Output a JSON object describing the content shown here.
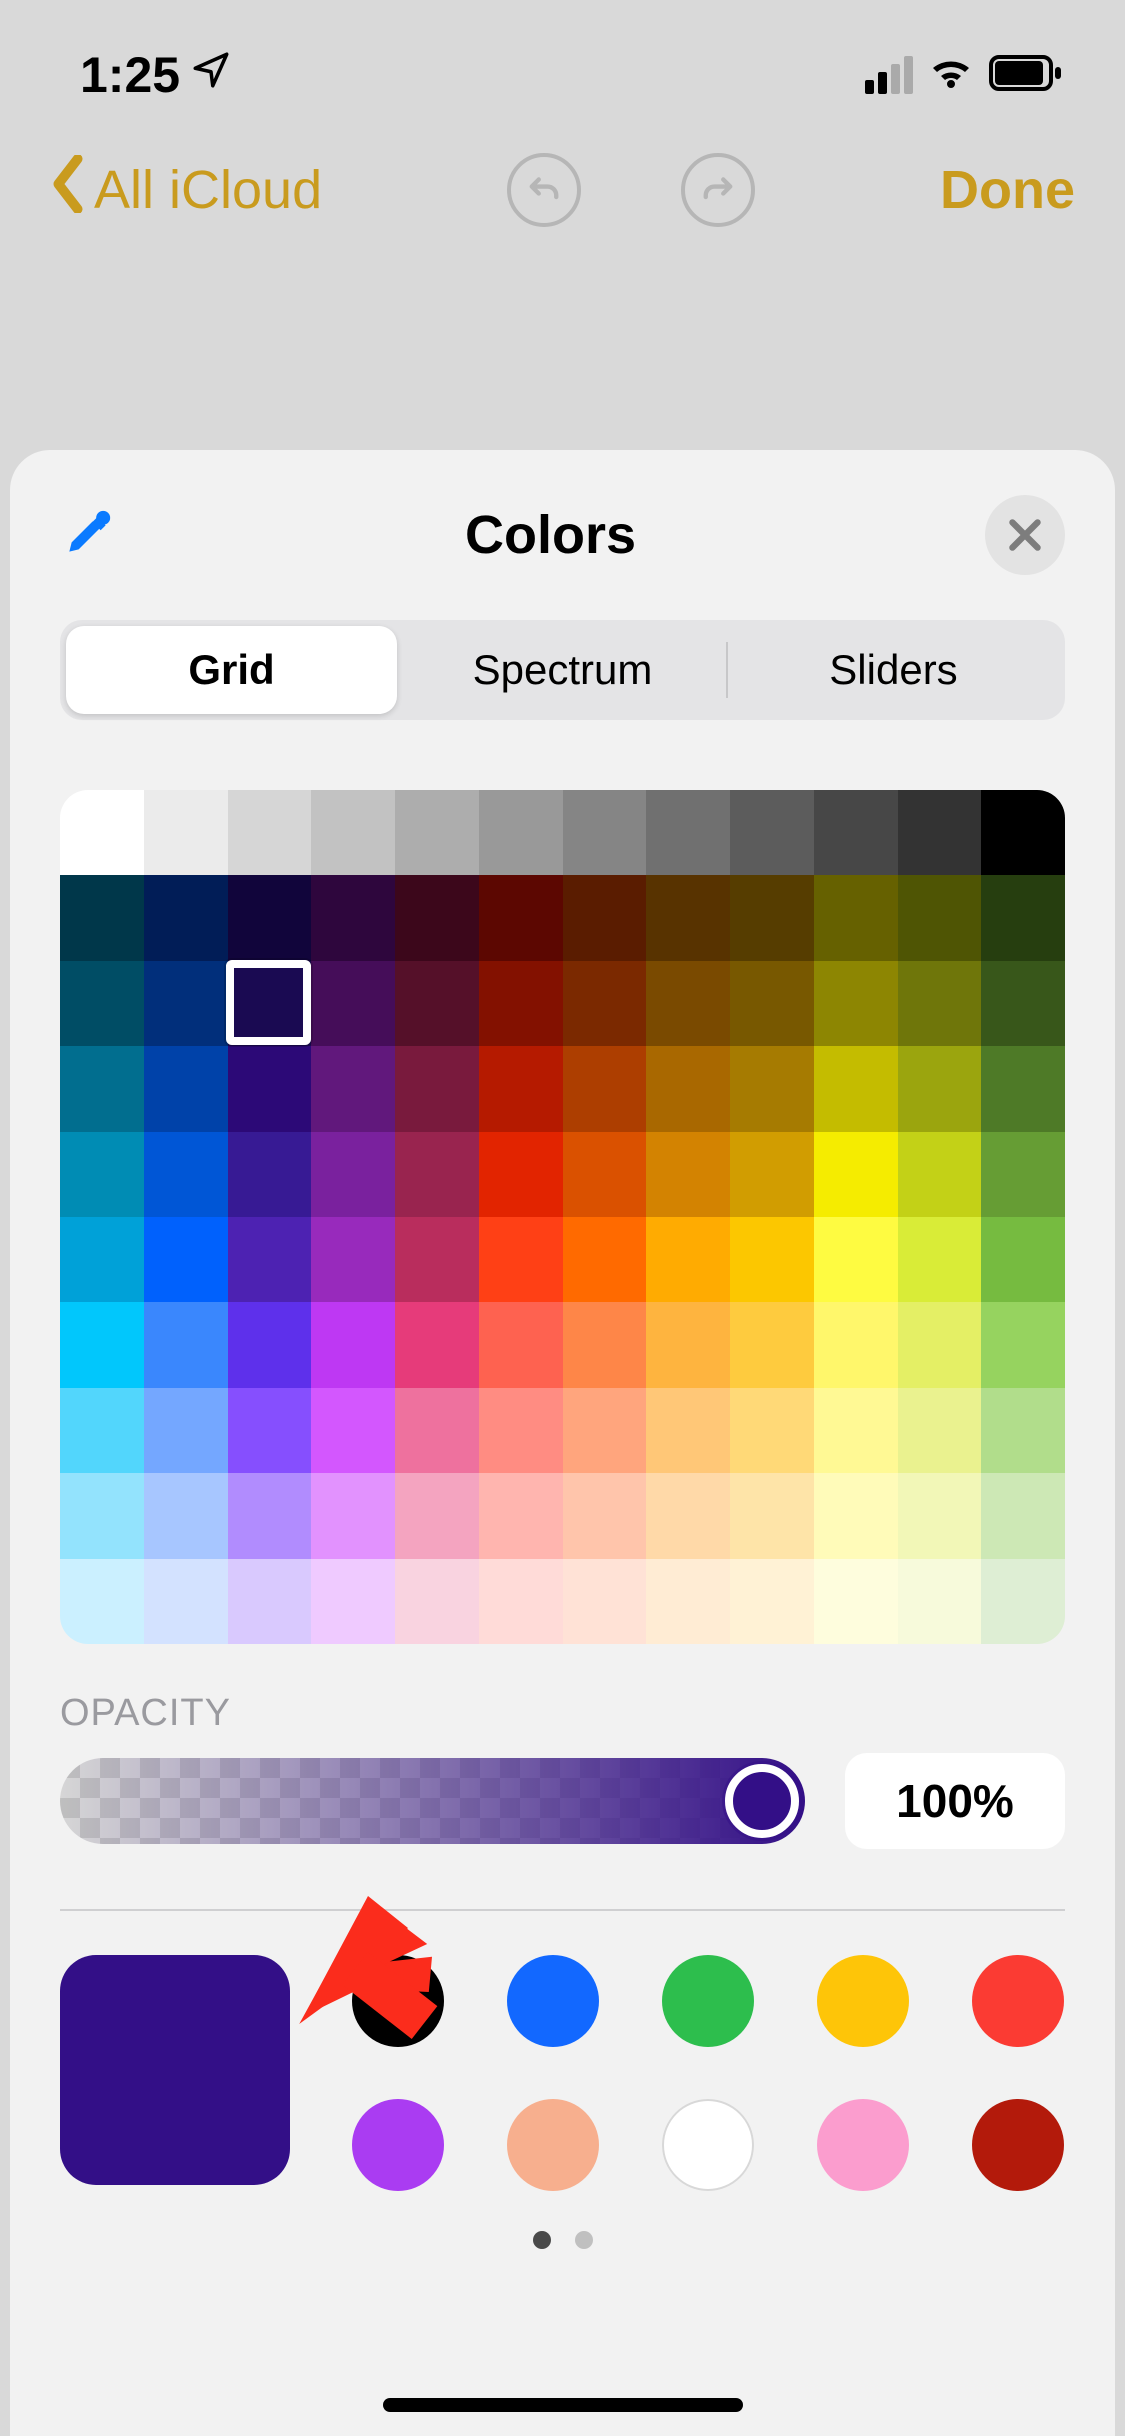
{
  "status": {
    "time": "1:25"
  },
  "nav": {
    "back_label": "All iCloud",
    "done_label": "Done"
  },
  "picker": {
    "title": "Colors",
    "tabs": [
      "Grid",
      "Spectrum",
      "Sliders"
    ],
    "selected_tab": 0,
    "opacity_label": "OPACITY",
    "opacity_value": "100%",
    "selected_color": "#330f87",
    "grid_selection": {
      "row": 2,
      "col": 2
    },
    "swatches_row1": [
      "#000000",
      "#1268ff",
      "#2dbe4d",
      "#fec508",
      "#fb3b33"
    ],
    "swatches_row2": [
      "#aa3cf2",
      "#f7af8e",
      "#ffffff",
      "#fb9dce",
      "#b31a0b"
    ],
    "grid_rows": [
      [
        "#ffffff",
        "#ebebeb",
        "#d6d6d6",
        "#c2c2c2",
        "#adadad",
        "#999999",
        "#858585",
        "#707070",
        "#5c5c5c",
        "#474747",
        "#333333",
        "#000000"
      ],
      [
        "#00374a",
        "#011d57",
        "#11053b",
        "#2e063d",
        "#3c071b",
        "#5c0701",
        "#5a1c00",
        "#583300",
        "#563d00",
        "#666100",
        "#4f5504",
        "#263e0f"
      ],
      [
        "#004d65",
        "#012f7b",
        "#1a0a52",
        "#450d59",
        "#551029",
        "#831100",
        "#7b2900",
        "#7a4a00",
        "#785800",
        "#8d8602",
        "#6f760a",
        "#38571a"
      ],
      [
        "#016e8f",
        "#0042a9",
        "#2c0977",
        "#61187c",
        "#791a3d",
        "#b51a00",
        "#ad3e00",
        "#a96800",
        "#a67b01",
        "#c4bc00",
        "#9ba50e",
        "#4e7a27"
      ],
      [
        "#008cb4",
        "#0056d6",
        "#371a94",
        "#7a219e",
        "#99244f",
        "#e22400",
        "#da5100",
        "#d38301",
        "#d19d01",
        "#f5ec00",
        "#c3d117",
        "#669d34"
      ],
      [
        "#00a1d8",
        "#0061fd",
        "#4d22b2",
        "#982abc",
        "#b92d5d",
        "#ff4015",
        "#ff6a00",
        "#ffab01",
        "#fcc700",
        "#fefb41",
        "#d9ec37",
        "#76bb40"
      ],
      [
        "#01c7fc",
        "#3a87fd",
        "#5e30eb",
        "#be38f3",
        "#e63b7a",
        "#fe6250",
        "#fe8648",
        "#feb43f",
        "#fecb3e",
        "#fff76b",
        "#e4ef65",
        "#96d35f"
      ],
      [
        "#52d6fc",
        "#74a7ff",
        "#864ffe",
        "#d357fe",
        "#ee719e",
        "#ff8c82",
        "#ffa57d",
        "#ffc777",
        "#ffd977",
        "#fff994",
        "#eaf28f",
        "#b1dd8b"
      ],
      [
        "#93e3fd",
        "#a7c6ff",
        "#b18cfe",
        "#e292fe",
        "#f4a4c0",
        "#ffb5af",
        "#ffc5ab",
        "#ffd9a8",
        "#fee4a8",
        "#fffbb9",
        "#f2f7b7",
        "#cde8b5"
      ],
      [
        "#cbf0ff",
        "#d3e2ff",
        "#d9c9fe",
        "#efcaff",
        "#f9d3e0",
        "#ffdbd8",
        "#ffe2d6",
        "#ffecd4",
        "#fff2d5",
        "#fefddd",
        "#f7fadb",
        "#deeed4"
      ]
    ]
  }
}
